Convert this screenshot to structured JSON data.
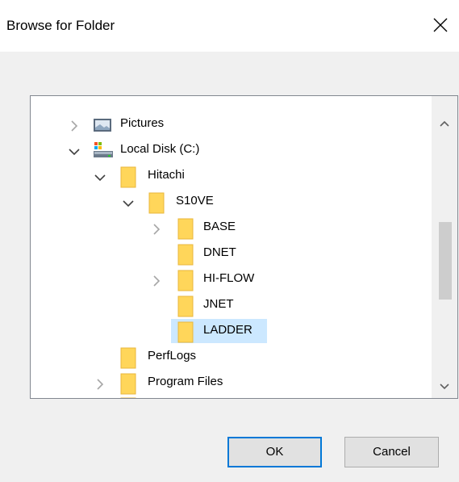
{
  "dialog": {
    "title": "Browse for Folder",
    "close_label": "×",
    "ok_label": "OK",
    "cancel_label": "Cancel"
  },
  "tree": {
    "items": [
      {
        "label": "Pictures",
        "icon": "pictures-icon",
        "expand": "collapsed"
      },
      {
        "label": "Local Disk (C:)",
        "icon": "drive-icon",
        "expand": "expanded"
      },
      {
        "label": "Hitachi",
        "icon": "folder-icon",
        "expand": "expanded"
      },
      {
        "label": "S10VE",
        "icon": "folder-icon",
        "expand": "expanded"
      },
      {
        "label": "BASE",
        "icon": "folder-icon",
        "expand": "collapsed"
      },
      {
        "label": "DNET",
        "icon": "folder-icon",
        "expand": "none"
      },
      {
        "label": "HI-FLOW",
        "icon": "folder-icon",
        "expand": "collapsed"
      },
      {
        "label": "JNET",
        "icon": "folder-icon",
        "expand": "none"
      },
      {
        "label": "LADDER",
        "icon": "folder-icon",
        "expand": "none",
        "selected": true
      },
      {
        "label": "PerfLogs",
        "icon": "folder-icon",
        "expand": "none"
      },
      {
        "label": "Program Files",
        "icon": "folder-icon",
        "expand": "collapsed"
      }
    ]
  },
  "colors": {
    "selection": "#cce8ff",
    "folder": "#ffd65a",
    "accent": "#0078d7"
  }
}
